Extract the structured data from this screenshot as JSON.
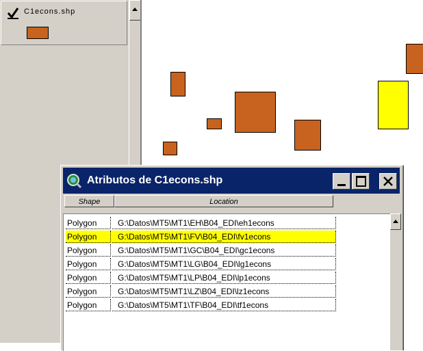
{
  "toc": {
    "layer": {
      "name": "C1econs.shp",
      "visible": true,
      "symbol_color": "#c8621f"
    }
  },
  "map": {
    "fill_color": "#c8621f",
    "highlight_color": "#ffff00"
  },
  "attributes_window": {
    "title": "Atributos de C1econs.shp",
    "icon": "globe-magnifier-icon",
    "columns": [
      "Shape",
      "Location"
    ],
    "rows": [
      {
        "shape": "Polygon",
        "location": "G:\\Datos\\MT5\\MT1\\EH\\B04_EDI\\eh1econs",
        "selected": false
      },
      {
        "shape": "Polygon",
        "location": "G:\\Datos\\MT5\\MT1\\FV\\B04_EDI\\fv1econs",
        "selected": true
      },
      {
        "shape": "Polygon",
        "location": "G:\\Datos\\MT5\\MT1\\GC\\B04_EDI\\gc1econs",
        "selected": false
      },
      {
        "shape": "Polygon",
        "location": "G:\\Datos\\MT5\\MT1\\LG\\B04_EDI\\lg1econs",
        "selected": false
      },
      {
        "shape": "Polygon",
        "location": "G:\\Datos\\MT5\\MT1\\LP\\B04_EDI\\lp1econs",
        "selected": false
      },
      {
        "shape": "Polygon",
        "location": "G:\\Datos\\MT5\\MT1\\LZ\\B04_EDI\\lz1econs",
        "selected": false
      },
      {
        "shape": "Polygon",
        "location": "G:\\Datos\\MT5\\MT1\\TF\\B04_EDI\\tf1econs",
        "selected": false
      }
    ]
  }
}
